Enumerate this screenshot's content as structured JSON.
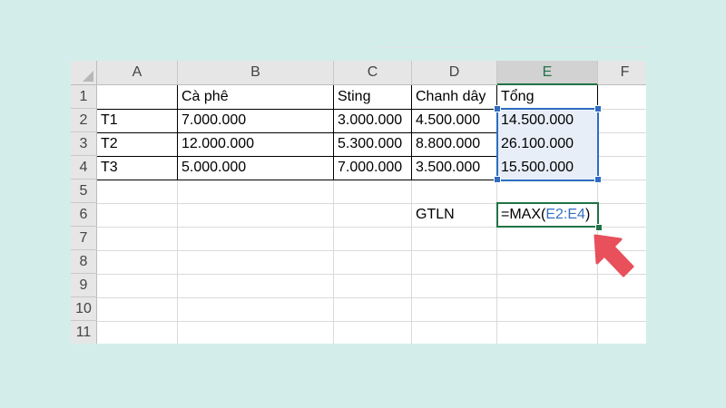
{
  "columns": [
    "A",
    "B",
    "C",
    "D",
    "E",
    "F"
  ],
  "selected_column": "E",
  "rows": [
    "1",
    "2",
    "3",
    "4",
    "5",
    "6",
    "7",
    "8",
    "9",
    "10",
    "11"
  ],
  "cells": {
    "B1": "Cà phê",
    "C1": "Sting",
    "D1": "Chanh dây",
    "E1": "Tổng",
    "A2": "T1",
    "B2": "7.000.000",
    "C2": "3.000.000",
    "D2": "4.500.000",
    "E2": "14.500.000",
    "A3": "T2",
    "B3": "12.000.000",
    "C3": "5.300.000",
    "D3": "8.800.000",
    "E3": "26.100.000",
    "A4": "T3",
    "B4": "5.000.000",
    "C4": "7.000.000",
    "D4": "3.500.000",
    "E4": "15.500.000",
    "D6": "GTLN"
  },
  "formula": {
    "cell": "E6",
    "prefix": "=MAX(",
    "range": "E2:E4",
    "suffix": ")"
  },
  "colors": {
    "background": "#d3eeea",
    "range_highlight": "#2e6dc0",
    "active_cell": "#217346",
    "arrow": "#e8505b"
  },
  "icons": {
    "pointer": "arrow-icon"
  }
}
